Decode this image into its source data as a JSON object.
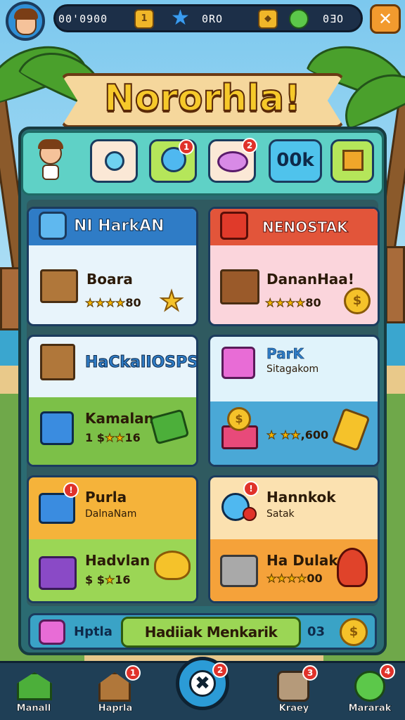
{
  "top_bar": {
    "resource_1": "00'0900",
    "resource_2": "0RO",
    "resource_3": "0ƎO",
    "coin_badge": "1",
    "close_symbol": "✕"
  },
  "banner": {
    "title": "Nororhla!"
  },
  "toolbar": {
    "badge_1": "1",
    "badge_2": "2",
    "button_ok": "00k"
  },
  "cards": [
    {
      "header": "NI HarkAN",
      "name": "Boara",
      "rating": "★★★★80",
      "head_color": "#2f7cc6"
    },
    {
      "header": "NENOSTAK",
      "name": "DananHaa!",
      "rating": "★★★★80",
      "head_color": "#e2553a"
    },
    {
      "header": "HaCkalIOSPS",
      "name": "Kamalan",
      "rating": "1 $★★16"
    },
    {
      "header": "ParK",
      "sub": "Sitagakom",
      "rating": "★ ★★,600"
    },
    {
      "header": "Purla",
      "sub": "DalnaNam",
      "name": "Hadvlan",
      "rating": "$ $★16"
    },
    {
      "header": "Hannkok",
      "sub": "Satak",
      "name": "Ha Dulak",
      "rating": "★★★★00"
    }
  ],
  "footer": {
    "label": "Hptla",
    "cta": "Hadiiak Menkarik",
    "count": "03"
  },
  "nav": [
    {
      "label": "Manall"
    },
    {
      "label": "Haprla",
      "badge": "1"
    },
    {
      "label": "",
      "badge": "2"
    },
    {
      "label": "Kraey",
      "badge": "3"
    },
    {
      "label": "Mararak",
      "badge": "4"
    }
  ]
}
